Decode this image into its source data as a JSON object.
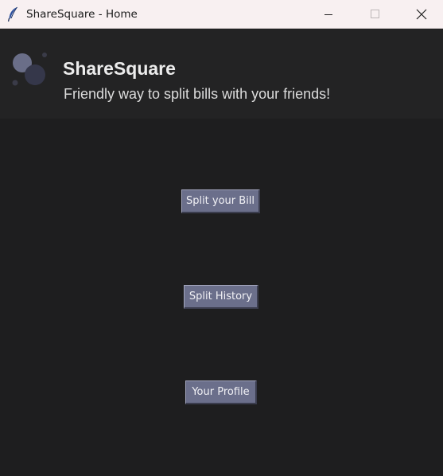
{
  "window": {
    "title": "ShareSquare - Home",
    "icons": {
      "app": "feather-icon",
      "minimize": "minimize-icon",
      "maximize": "maximize-icon",
      "close": "close-icon"
    }
  },
  "header": {
    "logo": "bubbles-logo",
    "title": "ShareSquare",
    "tagline": "Friendly way to split bills with your friends!"
  },
  "menu": {
    "split_bill": "Split your Bill",
    "split_history": "Split History",
    "your_profile": "Your Profile"
  },
  "colors": {
    "background": "#1e1e1f",
    "header_background": "#232324",
    "titlebar_background": "#f8f0f1",
    "button_face": "#6b6f8b",
    "button_text": "#f1f1f5"
  }
}
